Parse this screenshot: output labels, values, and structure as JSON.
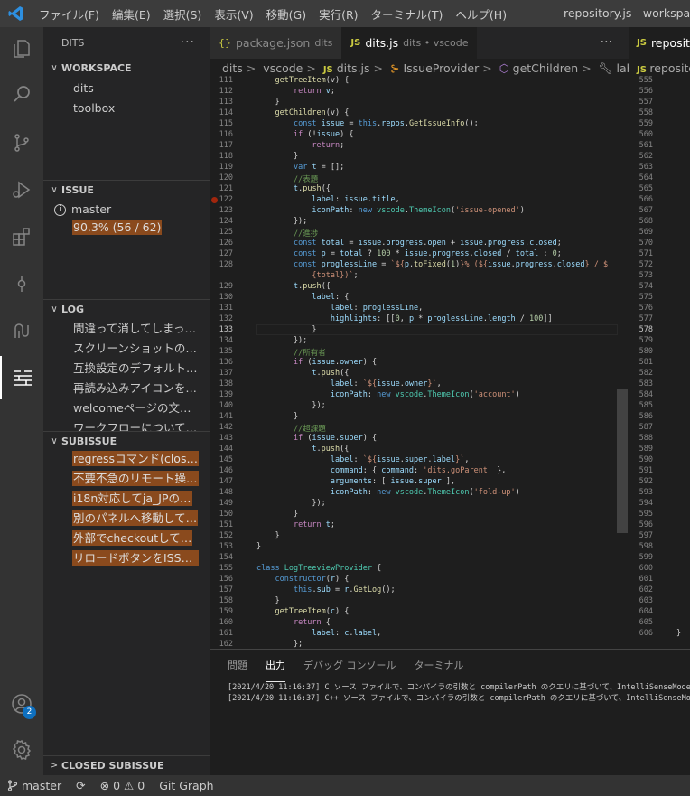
{
  "window": {
    "title": "repository.js - workspa",
    "menu": [
      "ファイル(F)",
      "編集(E)",
      "選択(S)",
      "表示(V)",
      "移動(G)",
      "実行(R)",
      "ターミナル(T)",
      "ヘルプ(H)"
    ]
  },
  "activity": {
    "account_badge": "2",
    "icons": [
      "files-icon",
      "search-icon",
      "source-control-icon",
      "run-debug-icon",
      "extensions-icon",
      "git-commit-icon",
      "gitlens-icon",
      "dits-icon",
      "account-icon",
      "settings-gear-icon"
    ]
  },
  "sidebar": {
    "title": "DITS",
    "more": "···",
    "workspace": {
      "header": "WORKSPACE",
      "items": [
        "dits",
        "toolbox"
      ]
    },
    "issue": {
      "header": "ISSUE",
      "branch": "master",
      "progress": "90.3% (56 / 62)"
    },
    "log": {
      "header": "LOG",
      "items": [
        "間違って消してしまっ…",
        "スクリーンショットの追加",
        "互換設定のデフォルト…",
        "再読み込みアイコンを…",
        "welcomeページの文…",
        "ワークフローについて…"
      ]
    },
    "subissue": {
      "header": "SUBISSUE",
      "items": [
        "regressコマンド(close…",
        "不要不急のリモート操…",
        "i18n対応してja_JPの…",
        "別のパネルへ移動して…",
        "外部でcheckoutして…",
        "リロードボタンをISSUE…"
      ]
    },
    "closed": {
      "header": "CLOSED SUBISSUE"
    }
  },
  "editor": {
    "tabs": [
      {
        "icon": "{}",
        "name": "package.json",
        "desc": "dits"
      },
      {
        "icon": "JS",
        "name": "dits.js",
        "desc": "dits • vscode"
      }
    ],
    "more": "···",
    "breadcrumb": [
      "dits",
      "vscode",
      "dits.js",
      "IssueProvider",
      "getChildren",
      "label"
    ],
    "breadcrumb_icons": [
      "JS",
      "class-icon",
      "method-icon",
      "wrench-icon"
    ],
    "current_line": 133,
    "breakpoint_line": 122
  },
  "split": {
    "tab": "reposit",
    "breadcrumb": "reposito",
    "lines_start": 555,
    "lines_end": 606,
    "current_line": 578,
    "closing": "}"
  },
  "panel": {
    "tabs": [
      "問題",
      "出力",
      "デバッグ コンソール",
      "ターミナル"
    ],
    "active": "出力",
    "output": [
      "[2021/4/20 11:16:37] C ソース ファイルで、コンパイラの引数と compilerPath のクエリに基づいて、IntelliSenseMode が",
      "[2021/4/20 11:16:37] C++ ソース ファイルで、コンパイラの引数と compilerPath のクエリに基づいて、IntelliSenseMode が"
    ]
  },
  "status": {
    "branch": "master",
    "errors": "0",
    "warnings": "0",
    "git_graph": "Git Graph"
  }
}
